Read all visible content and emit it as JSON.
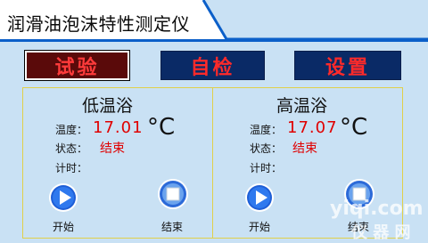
{
  "app": {
    "title": "润滑油泡沫特性测定仪"
  },
  "toolbar": {
    "test_label": "试验",
    "self_check_label": "自检",
    "settings_label": "设置"
  },
  "baths": [
    {
      "name": "低温浴",
      "temp_label": "温度：",
      "temp_value": "17.01",
      "unit": "°C",
      "status_label": "状态：",
      "status_value": "结束",
      "timer_label": "计时：",
      "timer_value": "",
      "start_label": "开始",
      "stop_label": "结束"
    },
    {
      "name": "高温浴",
      "temp_label": "温度：",
      "temp_value": "17.07",
      "unit": "°C",
      "status_label": "状态：",
      "status_value": "结束",
      "timer_label": "计时：",
      "timer_value": "",
      "start_label": "开始",
      "stop_label": "结束"
    }
  ],
  "watermark": {
    "line1": "yiqi.com",
    "line2": "仪 器 网"
  },
  "colors": {
    "background": "#c9e1f4",
    "accent_red": "#e00000",
    "title_bar_blue": "#0b5fc9",
    "button_blue": "#0a2a66"
  }
}
